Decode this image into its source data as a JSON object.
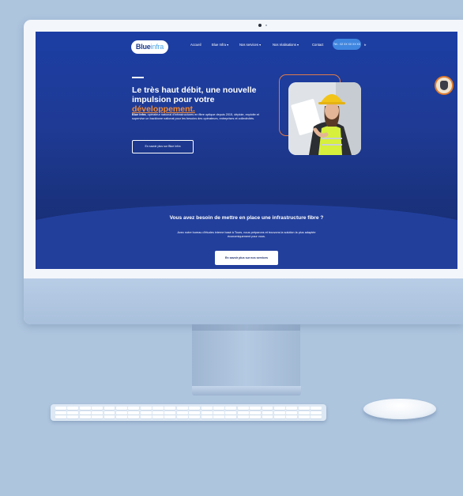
{
  "website": {
    "logo": {
      "part1": "Blue",
      "part2": "infra"
    },
    "nav": {
      "items": [
        "Accueil",
        "Blue Infra ▾",
        "Nos services ▾",
        "Nos réalisations ▾",
        "Contact"
      ],
      "phone": "Tél. : 02 XX XX XX XX",
      "lang": "fr"
    },
    "hero": {
      "title_main": "Le très haut débit, une nouvelle impulsion pour votre ",
      "title_highlight": "développement.",
      "desc_bold": "Blue Infra",
      "desc_rest": ", opérateur national d'infrastructures en fibre optique depuis 2015, déploie, exploite et supervise un backbone national pour les besoins des opérateurs, entreprises et collectivités.",
      "cta": "En savoir plus sur Blue Infra"
    },
    "band": {
      "title": "Vous avez besoin de mettre en place une infrastructure fibre ?",
      "desc": "Avec notre bureau d'études interne basé à Tours, nous préparons et trouvons la solution la plus adaptée économiquement pour vous.",
      "cta": "En savoir plus sur nos services"
    }
  },
  "colors": {
    "background": "#aec5de",
    "screen_blue": "#1c3ea4",
    "accent_orange": "#f28a34",
    "phone_button": "#3f86e0"
  }
}
